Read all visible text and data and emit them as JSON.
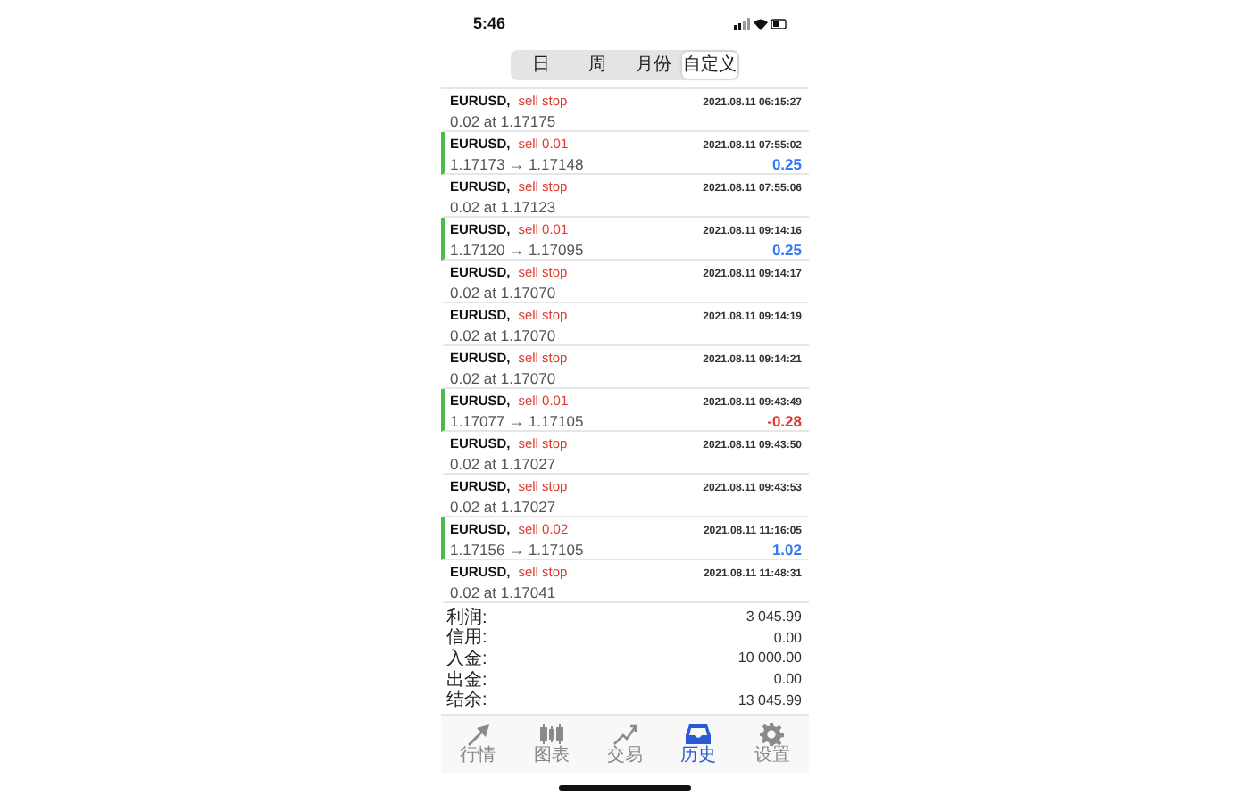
{
  "status_bar": {
    "time": "5:46"
  },
  "period_tabs": [
    {
      "label": "日",
      "selected": false
    },
    {
      "label": "周",
      "selected": false
    },
    {
      "label": "月份",
      "selected": false
    },
    {
      "label": "自定义",
      "selected": true
    }
  ],
  "history": [
    {
      "kind": "order",
      "symbol": "EURUSD,",
      "action": "sell stop",
      "time": "2021.08.11 06:15:27",
      "detail": "0.02 at 1.17175"
    },
    {
      "kind": "deal",
      "symbol": "EURUSD,",
      "action": "sell 0.01",
      "time": "2021.08.11 07:55:02",
      "detail": "1.17173 → 1.17148",
      "profit": "0.25",
      "color": "#3478f6"
    },
    {
      "kind": "order",
      "symbol": "EURUSD,",
      "action": "sell stop",
      "time": "2021.08.11 07:55:06",
      "detail": "0.02 at 1.17123"
    },
    {
      "kind": "deal",
      "symbol": "EURUSD,",
      "action": "sell 0.01",
      "time": "2021.08.11 09:14:16",
      "detail": "1.17120 → 1.17095",
      "profit": "0.25",
      "color": "#3478f6"
    },
    {
      "kind": "order",
      "symbol": "EURUSD,",
      "action": "sell stop",
      "time": "2021.08.11 09:14:17",
      "detail": "0.02 at 1.17070"
    },
    {
      "kind": "order",
      "symbol": "EURUSD,",
      "action": "sell stop",
      "time": "2021.08.11 09:14:19",
      "detail": "0.02 at 1.17070"
    },
    {
      "kind": "order",
      "symbol": "EURUSD,",
      "action": "sell stop",
      "time": "2021.08.11 09:14:21",
      "detail": "0.02 at 1.17070"
    },
    {
      "kind": "deal",
      "symbol": "EURUSD,",
      "action": "sell 0.01",
      "time": "2021.08.11 09:43:49",
      "detail": "1.17077 → 1.17105",
      "profit": "-0.28",
      "color": "#e0392b"
    },
    {
      "kind": "order",
      "symbol": "EURUSD,",
      "action": "sell stop",
      "time": "2021.08.11 09:43:50",
      "detail": "0.02 at 1.17027"
    },
    {
      "kind": "order",
      "symbol": "EURUSD,",
      "action": "sell stop",
      "time": "2021.08.11 09:43:53",
      "detail": "0.02 at 1.17027"
    },
    {
      "kind": "deal",
      "symbol": "EURUSD,",
      "action": "sell 0.02",
      "time": "2021.08.11 11:16:05",
      "detail": "1.17156 → 1.17105",
      "profit": "1.02",
      "color": "#3478f6"
    },
    {
      "kind": "order",
      "symbol": "EURUSD,",
      "action": "sell stop",
      "time": "2021.08.11 11:48:31",
      "detail": "0.02 at 1.17041"
    }
  ],
  "summary": [
    {
      "label": "利润:",
      "value": "3 045.99"
    },
    {
      "label": "信用:",
      "value": "0.00"
    },
    {
      "label": "入金:",
      "value": "10 000.00"
    },
    {
      "label": "出金:",
      "value": "0.00"
    },
    {
      "label": "结余:",
      "value": "13 045.99"
    }
  ],
  "bottom_tabs": [
    {
      "label": "行情",
      "kind": "quotes",
      "selected": false
    },
    {
      "label": "图表",
      "kind": "chart",
      "selected": false
    },
    {
      "label": "交易",
      "kind": "trade",
      "selected": false
    },
    {
      "label": "历史",
      "kind": "history",
      "selected": true
    },
    {
      "label": "设置",
      "kind": "settings",
      "selected": false
    }
  ]
}
